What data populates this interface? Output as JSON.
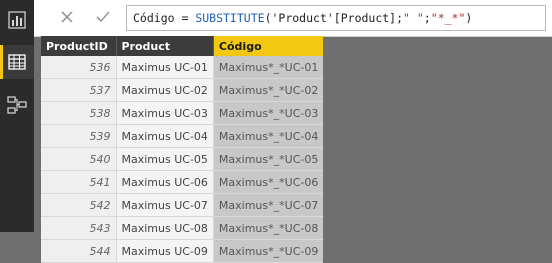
{
  "formula": {
    "prefix": "Código = ",
    "function": "SUBSTITUTE",
    "args_open": "('Product'[Product];",
    "string1": "\" \"",
    "separator": ";",
    "string2": "\"*_*\"",
    "close": ")",
    "cancel_icon": "close-icon",
    "commit_icon": "checkmark-icon"
  },
  "rail": {
    "items": [
      "report-view-icon",
      "data-view-icon",
      "model-view-icon"
    ]
  },
  "table": {
    "columns": [
      "ProductID",
      "Product",
      "Código"
    ],
    "rows": [
      [
        "536",
        "Maximus UC-01",
        "Maximus*_*UC-01"
      ],
      [
        "537",
        "Maximus UC-02",
        "Maximus*_*UC-02"
      ],
      [
        "538",
        "Maximus UC-03",
        "Maximus*_*UC-03"
      ],
      [
        "539",
        "Maximus UC-04",
        "Maximus*_*UC-04"
      ],
      [
        "540",
        "Maximus UC-05",
        "Maximus*_*UC-05"
      ],
      [
        "541",
        "Maximus UC-06",
        "Maximus*_*UC-06"
      ],
      [
        "542",
        "Maximus UC-07",
        "Maximus*_*UC-07"
      ],
      [
        "543",
        "Maximus UC-08",
        "Maximus*_*UC-08"
      ],
      [
        "544",
        "Maximus UC-09",
        "Maximus*_*UC-09"
      ]
    ]
  },
  "colors": {
    "accent": "#f2c811",
    "header_bg": "#3c3c3c",
    "rail_bg": "#2b2b2b",
    "canvas_bg": "#6f6f6f"
  }
}
